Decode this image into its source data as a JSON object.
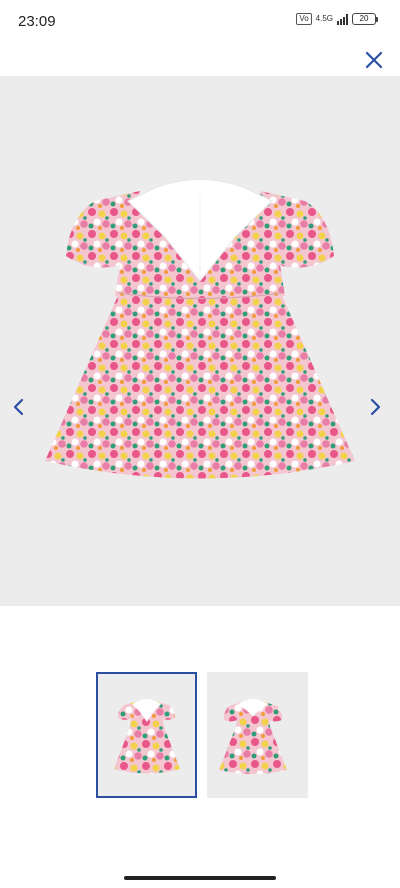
{
  "status_bar": {
    "time": "23:09",
    "vo_label": "Vo",
    "network_label": "4.5G",
    "battery_level": "20"
  },
  "gallery": {
    "main_image_alt": "floral-dress-product-photo",
    "close_icon": "close-icon",
    "prev_icon": "chevron-left-icon",
    "next_icon": "chevron-right-icon",
    "selected_thumbnail": 1,
    "thumbnail_count": 2
  },
  "colors": {
    "accent": "#2a4fa3",
    "image_bg": "#ececec"
  }
}
